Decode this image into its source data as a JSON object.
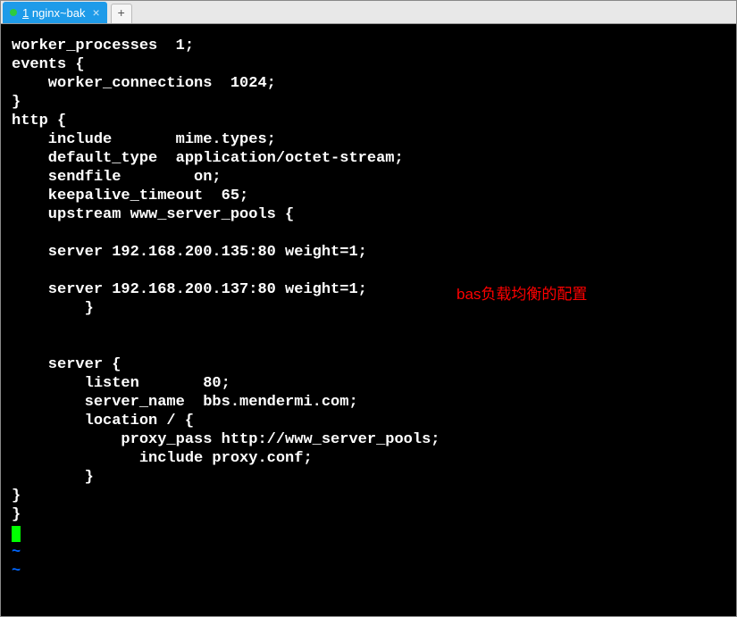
{
  "tab": {
    "number": "1",
    "title": "nginx~bak"
  },
  "editor": {
    "lines": [
      "worker_processes  1;",
      "events {",
      "    worker_connections  1024;",
      "}",
      "http {",
      "    include       mime.types;",
      "    default_type  application/octet-stream;",
      "    sendfile        on;",
      "    keepalive_timeout  65;",
      "    upstream www_server_pools {",
      "",
      "    server 192.168.200.135:80 weight=1;",
      "",
      "    server 192.168.200.137:80 weight=1;",
      "        }",
      "",
      "",
      "    server {",
      "        listen       80;",
      "        server_name  bbs.mendermi.com;",
      "        location / {",
      "            proxy_pass http://www_server_pools;",
      "              include proxy.conf;",
      "        }",
      "}",
      "}"
    ],
    "tildes": [
      "~",
      "~"
    ]
  },
  "annotation": "bas负载均衡的配置"
}
